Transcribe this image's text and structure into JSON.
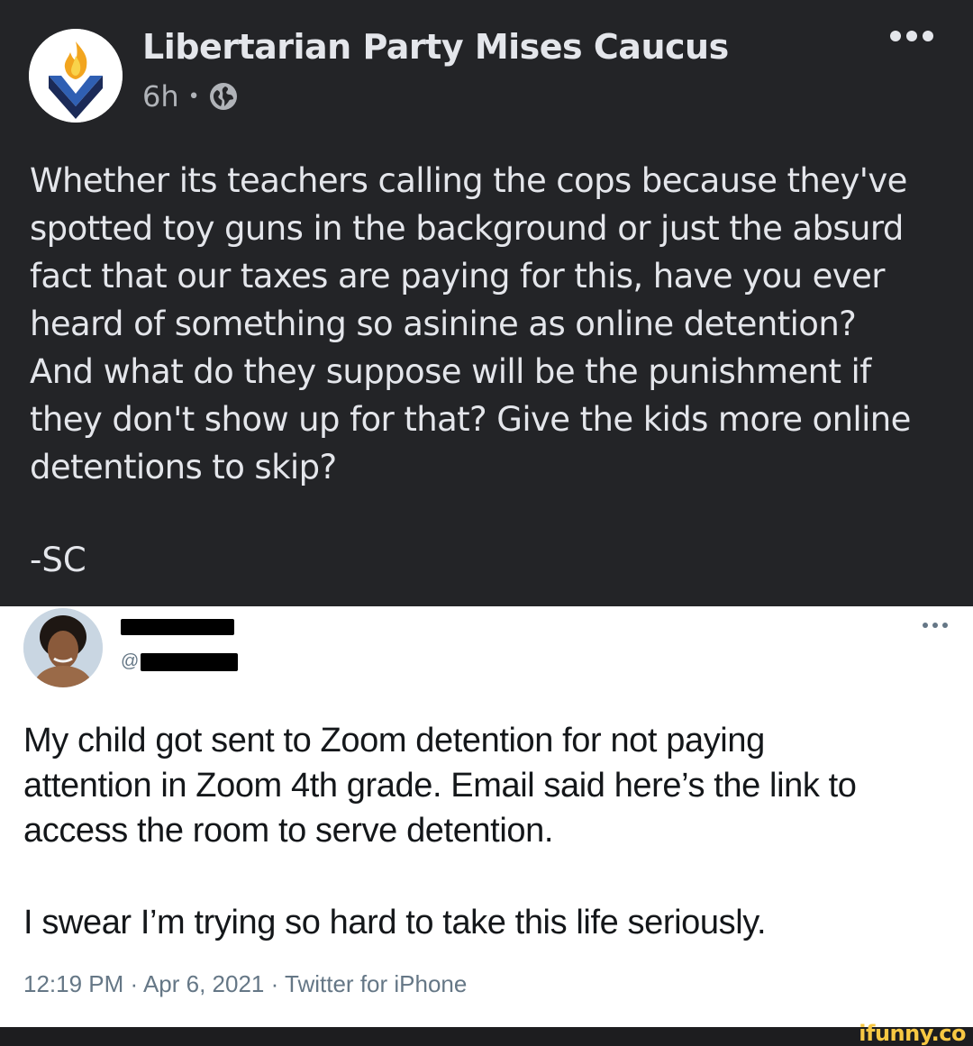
{
  "fb_post": {
    "page_name": "Libertarian Party Mises Caucus",
    "time": "6h",
    "separator": "•",
    "visibility_icon": "globe-icon",
    "more_icon": "more-horizontal-icon",
    "body_lines": [
      "Whether its teachers calling the cops because they've",
      "spotted toy guns in the background or just the absurd",
      "fact that our taxes are paying for this, have you ever",
      "heard of something so asinine as online detention?",
      "And what do they suppose will be the punishment if",
      "they don't show up for that? Give the kids more online",
      "detentions to skip?"
    ],
    "signature": "-SC",
    "colors": {
      "background": "#232427",
      "text": "#e4e6eb",
      "secondary": "#b0b3b8"
    }
  },
  "tweet": {
    "handle_prefix": "@",
    "more_icon": "more-horizontal-icon",
    "body_lines": [
      "My child got sent to Zoom detention for not paying",
      "attention in Zoom 4th grade. Email said here’s the link to",
      "access the room to serve detention."
    ],
    "body2": "I swear I’m trying so hard to take this life seriously.",
    "meta": "12:19 PM · Apr 6, 2021 · Twitter for iPhone",
    "colors": {
      "text": "#14171a",
      "secondary": "#657786"
    }
  },
  "watermark": "ifunny.co"
}
